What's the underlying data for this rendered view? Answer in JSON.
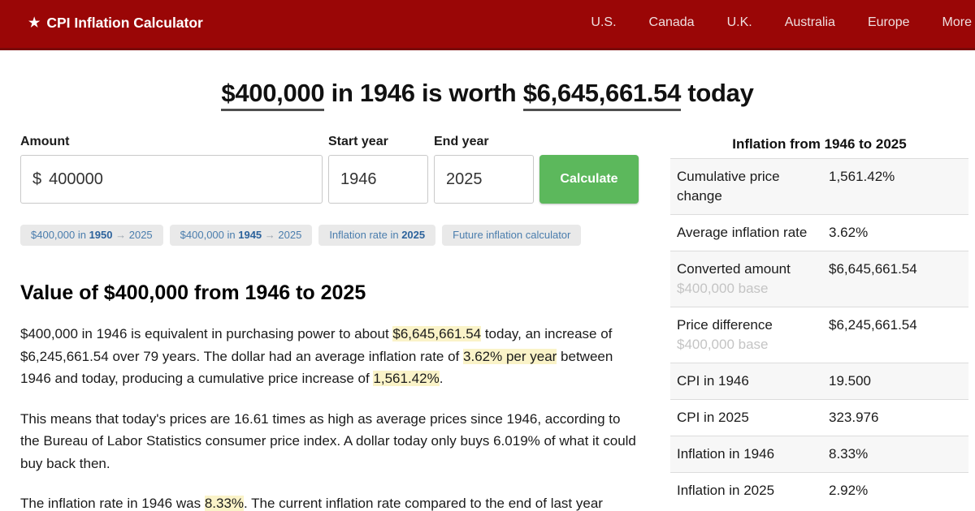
{
  "colors": {
    "navbar_red": "#9a0606",
    "navbar_border": "#7a0808",
    "button_green": "#5cb85c",
    "highlight_yellow": "#faf3c8",
    "chip_blue": "#4a7dad"
  },
  "navbar": {
    "star": "★",
    "brand": "CPI Inflation Calculator",
    "links": [
      "U.S.",
      "Canada",
      "U.K.",
      "Australia",
      "Europe",
      "More"
    ]
  },
  "headline": {
    "amount_from": "$400,000",
    "middle": " in 1946 is worth ",
    "amount_to": "$6,645,661.54",
    "suffix": " today"
  },
  "form": {
    "amount_label": "Amount",
    "amount_prefix": "$",
    "amount_value": "400000",
    "start_label": "Start year",
    "start_value": "1946",
    "end_label": "End year",
    "end_value": "2025",
    "calculate_label": "Calculate"
  },
  "chips": [
    {
      "prefix": "$400,000 in ",
      "year": "1950",
      "arrow": " → ",
      "suffix": "2025"
    },
    {
      "prefix": "$400,000 in ",
      "year": "1945",
      "arrow": " → ",
      "suffix": "2025"
    },
    {
      "prefix": "Inflation rate in ",
      "year": "2025",
      "arrow": "",
      "suffix": ""
    },
    {
      "prefix": "Future inflation calculator",
      "year": "",
      "arrow": "",
      "suffix": ""
    }
  ],
  "article": {
    "heading": "Value of $400,000 from 1946 to 2025",
    "p1": [
      {
        "t": "$400,000 in 1946 is equivalent in purchasing power to about "
      },
      {
        "t": "$6,645,661.54"
      },
      {
        "t": " today, an increase of $6,245,661.54 over 79 years. The dollar had an average inflation rate of "
      },
      {
        "t": "3.62% per year"
      },
      {
        "t": " between 1946 and today, producing a cumulative price increase of "
      },
      {
        "t": "1,561.42%"
      },
      {
        "t": "."
      }
    ],
    "p2": [
      {
        "t": "This means that today's prices are 16.61 times as high as average prices since 1946, according to the Bureau of Labor Statistics consumer price index. A dollar today only buys 6.019% of what it could buy back then."
      }
    ],
    "p3": [
      {
        "t": "The inflation rate in 1946 was "
      },
      {
        "t": "8.33%"
      },
      {
        "t": ". The current inflation rate compared to the end of last year"
      }
    ]
  },
  "sidebar": {
    "title": "Inflation from 1946 to 2025",
    "rows": [
      {
        "label": "Cumulative price change",
        "sub": "",
        "value": "1,561.42%"
      },
      {
        "label": "Average inflation rate",
        "sub": "",
        "value": "3.62%"
      },
      {
        "label": "Converted amount",
        "sub": "$400,000 base",
        "value": "$6,645,661.54"
      },
      {
        "label": "Price difference",
        "sub": "$400,000 base",
        "value": "$6,245,661.54"
      },
      {
        "label": "CPI in 1946",
        "sub": "",
        "value": "19.500"
      },
      {
        "label": "CPI in 2025",
        "sub": "",
        "value": "323.976"
      },
      {
        "label": "Inflation in 1946",
        "sub": "",
        "value": "8.33%"
      },
      {
        "label": "Inflation in 2025",
        "sub": "",
        "value": "2.92%"
      }
    ]
  }
}
